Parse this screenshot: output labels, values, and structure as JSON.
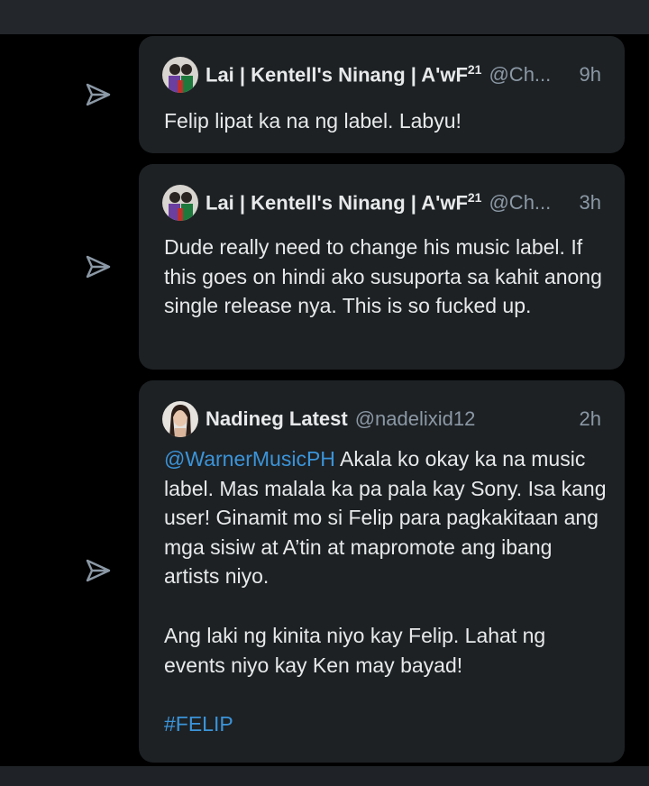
{
  "tweets": [
    {
      "author": "Lai | Kentell's Ninang | A'wF",
      "author_sup": "21",
      "handle": "@Ch...",
      "time": "9h",
      "text": "Felip lipat ka na ng label. Labyu!"
    },
    {
      "author": "Lai | Kentell's Ninang | A'wF",
      "author_sup": "21",
      "handle": "@Ch...",
      "time": "3h",
      "text": "Dude really need to change his music label. If this goes on hindi ako susuporta sa kahit anong single release nya. This is so fucked up."
    },
    {
      "author": "Nadineg Latest",
      "handle": "@nadelixid12",
      "time": "2h",
      "mention": "@WarnerMusicPH",
      "text_after_mention": " Akala ko okay ka na music label. Mas malala ka pa pala kay Sony. Isa kang user! Ginamit mo si Felip para pagkakitaan ang mga sisiw at A’tin at mapromote ang ibang artists niyo.",
      "text_p2": "Ang laki ng kinita niyo kay Felip. Lahat ng events niyo kay Ken may bayad!",
      "hashtag": "#FELIP"
    }
  ],
  "icons": {
    "share": "share-send-icon"
  },
  "colors": {
    "card_bg": "#1d2124",
    "link": "#3b94d9",
    "muted": "#8b98a5",
    "text": "#e7e9ea"
  }
}
